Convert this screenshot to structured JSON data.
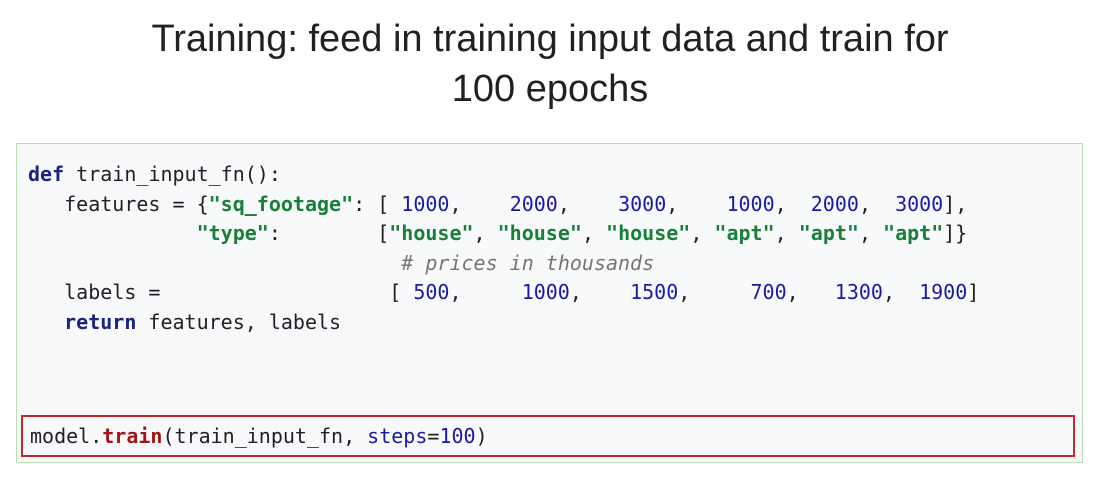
{
  "slide": {
    "title_line1": "Training: feed in training input data and train for",
    "title_line2": "100 epochs"
  },
  "code": {
    "line1": {
      "kw": "def",
      "rest": " train_input_fn():"
    },
    "line2": {
      "lead": "   features = {",
      "key": "\"sq_footage\"",
      "mid": ": [ ",
      "values": [
        "1000",
        "2000",
        "3000",
        "1000",
        "2000",
        "3000"
      ],
      "end": "],"
    },
    "line3": {
      "lead": "              ",
      "key": "\"type\"",
      "mid": ":        [",
      "values": [
        "\"house\"",
        "\"house\"",
        "\"house\"",
        "\"apt\"",
        "\"apt\"",
        "\"apt\""
      ],
      "end": "]}"
    },
    "line4": {
      "lead": "                               ",
      "comment": "# prices in thousands"
    },
    "line5": {
      "lead": "   labels =                   [ ",
      "values": [
        "500",
        "1000",
        "1500",
        "700",
        "1300",
        "1900"
      ],
      "end": "]"
    },
    "line6": {
      "lead": "   ",
      "kw": "return",
      "rest": " features, labels"
    }
  },
  "train_call": {
    "obj": "model.",
    "method": "train",
    "open": "(train_input_fn, ",
    "param": "steps",
    "eq": "=",
    "value": "100",
    "close": ")"
  },
  "colors": {
    "keyword": "#1a237e",
    "string": "#188038",
    "number": "#1a1aa6",
    "comment": "#757575",
    "highlight_border": "#c62828",
    "code_border": "#b7e1b0"
  }
}
